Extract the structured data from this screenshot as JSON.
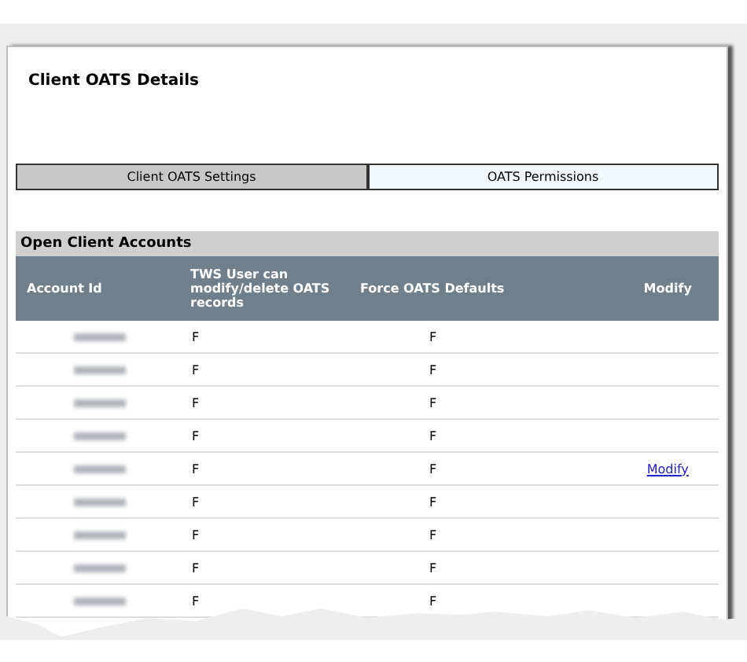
{
  "panel": {
    "title": "Client OATS Details"
  },
  "tabs": [
    {
      "label": "Client OATS Settings",
      "selected": false
    },
    {
      "label": "OATS Permissions",
      "selected": true
    }
  ],
  "accounts": {
    "heading": "Open Client Accounts",
    "columns": [
      "Account Id",
      "TWS User can modify/delete OATS records",
      "Force OATS Defaults",
      "Modify"
    ],
    "rows": [
      {
        "tws_can_modify": "F",
        "force_defaults": "F"
      },
      {
        "tws_can_modify": "F",
        "force_defaults": "F"
      },
      {
        "tws_can_modify": "F",
        "force_defaults": "F"
      },
      {
        "tws_can_modify": "F",
        "force_defaults": "F"
      },
      {
        "tws_can_modify": "F",
        "force_defaults": "F",
        "modify": "Modify"
      },
      {
        "tws_can_modify": "F",
        "force_defaults": "F"
      },
      {
        "tws_can_modify": "F",
        "force_defaults": "F"
      },
      {
        "tws_can_modify": "F",
        "force_defaults": "F"
      },
      {
        "tws_can_modify": "F",
        "force_defaults": "F"
      }
    ]
  }
}
